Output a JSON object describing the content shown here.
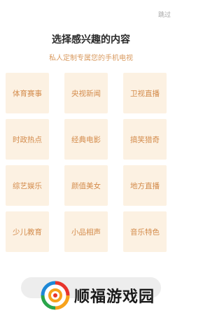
{
  "header": {
    "skip_label": "跳过",
    "title": "选择感兴趣的内容",
    "subtitle": "私人定制专属您的手机电视"
  },
  "interests": [
    {
      "label": "体育赛事"
    },
    {
      "label": "央视新闻"
    },
    {
      "label": "卫视直播"
    },
    {
      "label": "时政热点"
    },
    {
      "label": "经典电影"
    },
    {
      "label": "搞笑猎奇"
    },
    {
      "label": "综艺娱乐"
    },
    {
      "label": "颜值美女"
    },
    {
      "label": "地方直播"
    },
    {
      "label": "少儿教育"
    },
    {
      "label": "小品相声"
    },
    {
      "label": "音乐特色"
    }
  ],
  "watermark": {
    "text": "顺福游戏园",
    "logo_icon": "swirl-logo-icon"
  },
  "colors": {
    "tile_bg": "#fcf1e2",
    "tile_text": "#d38b4b",
    "accent_subtitle": "#d99a5f"
  }
}
